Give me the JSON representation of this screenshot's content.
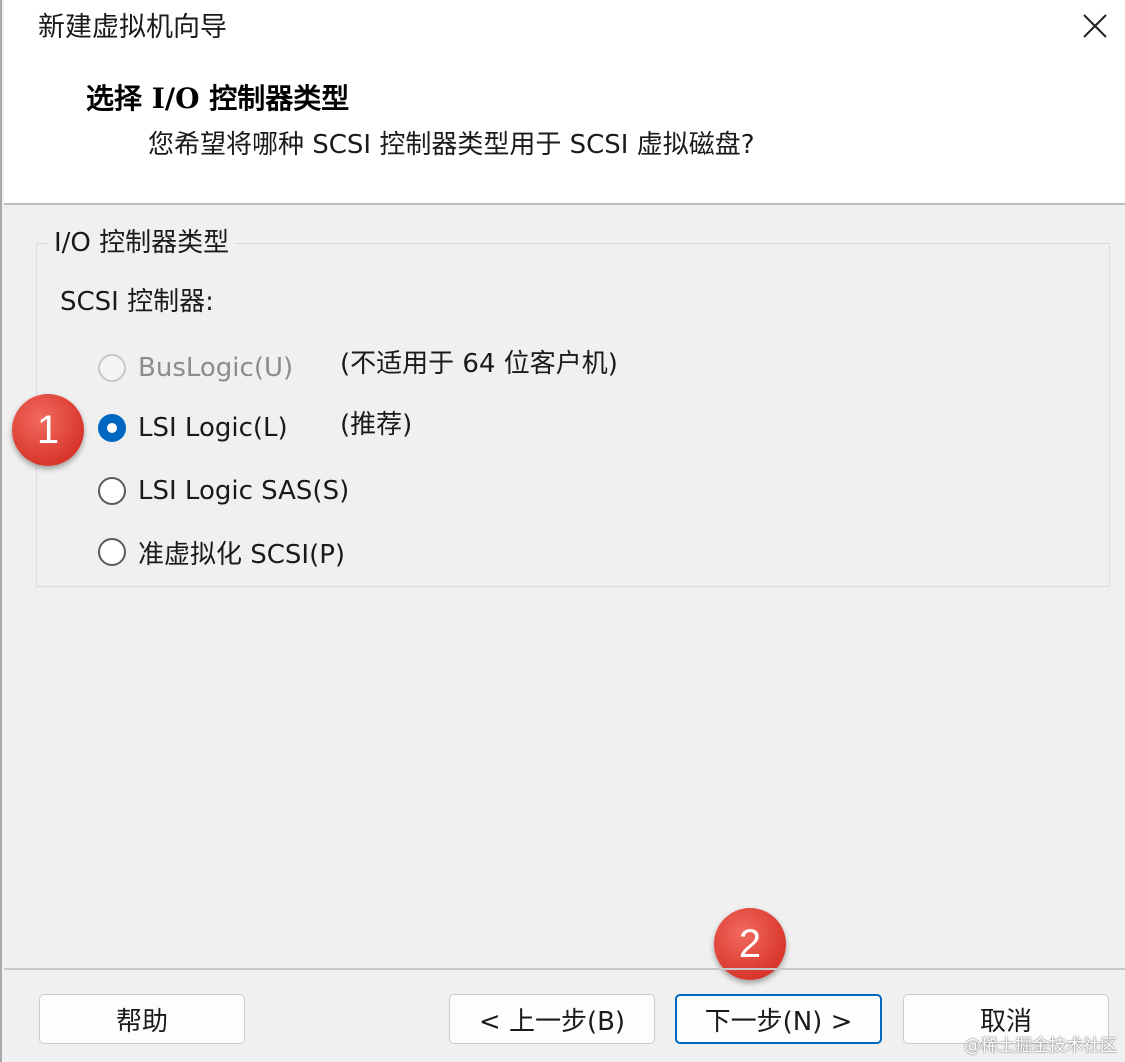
{
  "window": {
    "title": "新建虚拟机向导"
  },
  "header": {
    "page_title": "选择 I/O 控制器类型",
    "subtitle": "您希望将哪种 SCSI 控制器类型用于 SCSI 虚拟磁盘?"
  },
  "group": {
    "legend": "I/O 控制器类型",
    "scsi_label": "SCSI 控制器:",
    "options": [
      {
        "label": "BusLogic(U)",
        "note": "(不适用于 64 位客户机)",
        "enabled": false,
        "selected": false
      },
      {
        "label": "LSI Logic(L)",
        "note": "(推荐)",
        "enabled": true,
        "selected": true
      },
      {
        "label": "LSI Logic SAS(S)",
        "note": "",
        "enabled": true,
        "selected": false
      },
      {
        "label": "准虚拟化 SCSI(P)",
        "note": "",
        "enabled": true,
        "selected": false
      }
    ]
  },
  "annotations": {
    "badge_1": "1",
    "badge_2": "2"
  },
  "footer": {
    "help_label": "帮助",
    "back_label": "< 上一步(B)",
    "next_label": "下一步(N) >",
    "cancel_label": "取消"
  },
  "watermark": "@稀土掘金技术社区",
  "colors": {
    "accent": "#0067c0",
    "badge": "#d9372c"
  }
}
